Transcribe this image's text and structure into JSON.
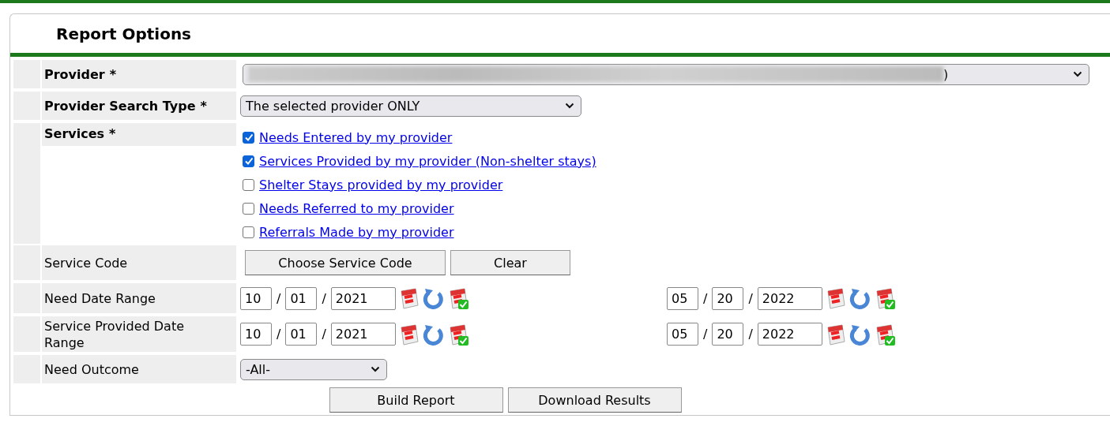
{
  "panel": {
    "title": "Report Options"
  },
  "fields": [
    {
      "kind": "select",
      "label": "Provider",
      "required_mark": "*",
      "value": ")",
      "redacted": true,
      "wide": true
    },
    {
      "kind": "select",
      "label": "Provider Search Type",
      "required_mark": "*",
      "value": "The selected provider ONLY",
      "redacted": false,
      "wide": false
    },
    {
      "kind": "checklist",
      "label": "Services",
      "required_mark": "*",
      "options": [
        {
          "label": "Needs Entered by my provider",
          "checked": true
        },
        {
          "label": "Services Provided by my provider (Non-shelter stays)",
          "checked": true
        },
        {
          "label": "Shelter Stays provided by my provider",
          "checked": false
        },
        {
          "label": "Needs Referred to my provider",
          "checked": false
        },
        {
          "label": "Referrals Made by my provider",
          "checked": false
        }
      ]
    },
    {
      "kind": "buttons",
      "label": "Service Code",
      "buttons": [
        "Choose Service Code",
        "Clear"
      ]
    },
    {
      "kind": "daterange",
      "label": "Need Date Range",
      "start": [
        "10",
        "01",
        "2021"
      ],
      "end": [
        "05",
        "20",
        "2022"
      ],
      "separator": "/"
    },
    {
      "kind": "daterange",
      "label": "Service Provided Date Range",
      "start": [
        "10",
        "01",
        "2021"
      ],
      "end": [
        "05",
        "20",
        "2022"
      ],
      "separator": "/"
    },
    {
      "kind": "smallselect",
      "label": "Need Outcome",
      "value": "-All-"
    }
  ],
  "actions": [
    "Build Report",
    "Download Results"
  ]
}
